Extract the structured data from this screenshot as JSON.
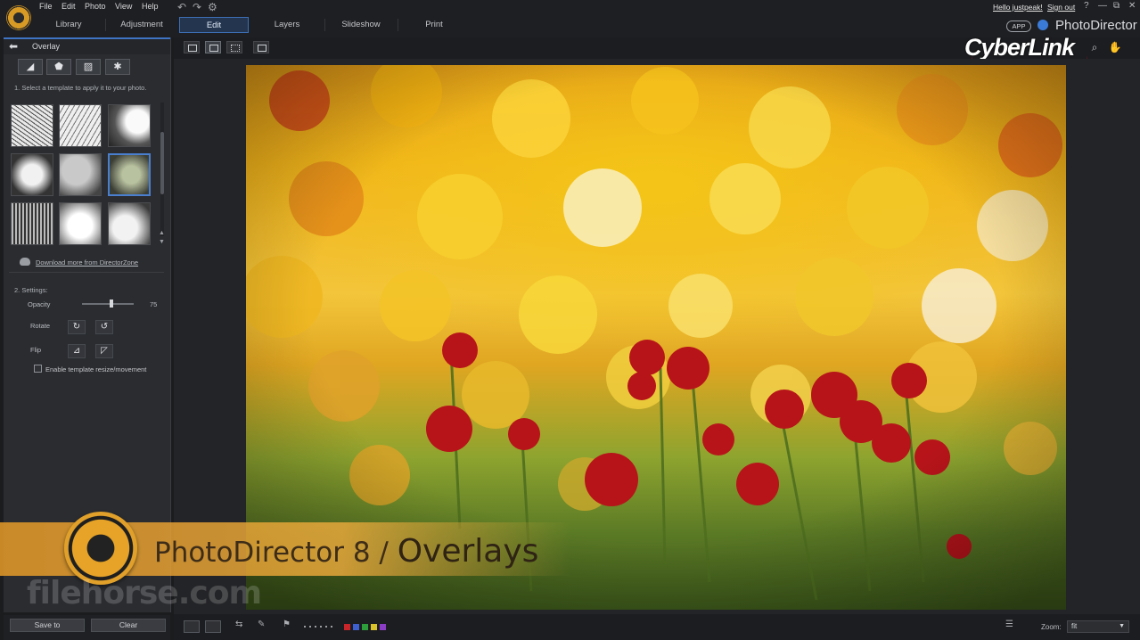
{
  "menu": {
    "file": "File",
    "edit": "Edit",
    "photo": "Photo",
    "view": "View",
    "help": "Help"
  },
  "tabs": [
    "Library",
    "Adjustment",
    "Edit",
    "Layers",
    "Slideshow",
    "Print"
  ],
  "active_tab": "Edit",
  "account": {
    "greeting": "Hello justpeak!",
    "sign_out": "Sign out"
  },
  "window_buttons": {
    "help": "?",
    "minimize": "—",
    "restore": "⧉",
    "close": "✕"
  },
  "brand": {
    "app_badge": "APP",
    "product": "PhotoDirector",
    "logo": "CyberLink"
  },
  "panel": {
    "title": "Overlay",
    "step1": "1. Select a template to apply it to your photo.",
    "download_link": "Download more from DirectorZone",
    "step2": "2. Settings:",
    "opacity_label": "Opacity",
    "opacity_value": "75",
    "rotate_label": "Rotate",
    "flip_label": "Flip",
    "resize_label": "Enable template resize/movement",
    "save_button": "Save to",
    "clear_button": "Clear"
  },
  "banner": {
    "title_part1": "PhotoDirector 8 / ",
    "title_part2": "Overlays",
    "watermark": "filehorse.com"
  },
  "zoom": {
    "label": "Zoom:",
    "value": "fit"
  },
  "colors": {
    "accent": "#3f74c4",
    "brand_red": "#c0152a",
    "color_labels": [
      "#c8252b",
      "#3d5fd0",
      "#2d9c3a",
      "#d9c229",
      "#8b3cc4"
    ]
  }
}
